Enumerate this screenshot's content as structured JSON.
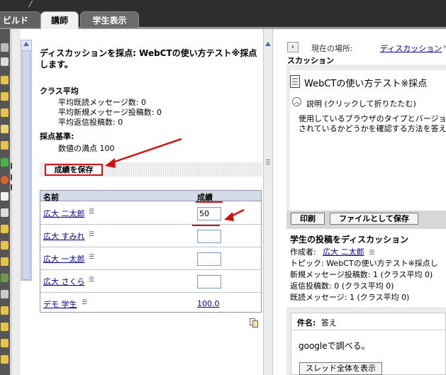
{
  "tabs": [
    {
      "label": "ビルド"
    },
    {
      "label": "講師"
    },
    {
      "label": "学生表示"
    }
  ],
  "grading": {
    "title": "ディスカッションを採点: WebCTの使い方テスト※採点します。",
    "class_average_label": "クラス平均",
    "stats": [
      "平均既読メッセージ数: 0",
      "平均新規メッセージ投稿数: 0",
      "平均返信投稿数: 0"
    ],
    "criteria_label": "採点基準:",
    "criteria_value": "数値の満点 100",
    "save_label": "成績を保存",
    "table": {
      "col_name": "名前",
      "col_score": "成績",
      "rows": [
        {
          "name": "広大 二太郎",
          "score": "50"
        },
        {
          "name": "広大 すみれ",
          "score": ""
        },
        {
          "name": "広大 一太郎",
          "score": ""
        },
        {
          "name": "広大 さくら",
          "score": ""
        },
        {
          "name": "デモ 学生",
          "score": "100.0"
        }
      ]
    }
  },
  "discussion": {
    "back_label": "‹",
    "location_label": "現在の場所:",
    "location_link": "ディスカッション",
    "location_sep": "›",
    "location_link2": "デ",
    "pane_title": "スカッション",
    "topic_title": "WebCTの使い方テスト※採点",
    "desc_label": "説明 (クリックして折りたたむ)",
    "desc_line1": "使用しているブラウザのタイプとバージョン",
    "desc_line2": "されているかどうかを確認する方法を答え",
    "print_label": "印刷",
    "savefile_label": "ファイルとして保存",
    "post_title": "学生の投稿をディスカッション",
    "author_label": "作成者:",
    "author_name": "広大 二太郎",
    "topic_line": "トピック: WebCTの使い方テスト※採点し",
    "new_posts": "新規メッセージ投稿数: 1 (クラス平均 0)",
    "replies": "返信投稿数: 0 (クラス平均 0)",
    "read": "既読メッセージ: 1 (クラス平均 0)",
    "subject_label": "件名:",
    "subject_value": "答え",
    "body": "googleで調べる。",
    "thread_label": "スレッド全体を表示"
  },
  "colors": {
    "link": "#00009c",
    "annotation": "#d11111",
    "table_header": "#d5dae8"
  }
}
